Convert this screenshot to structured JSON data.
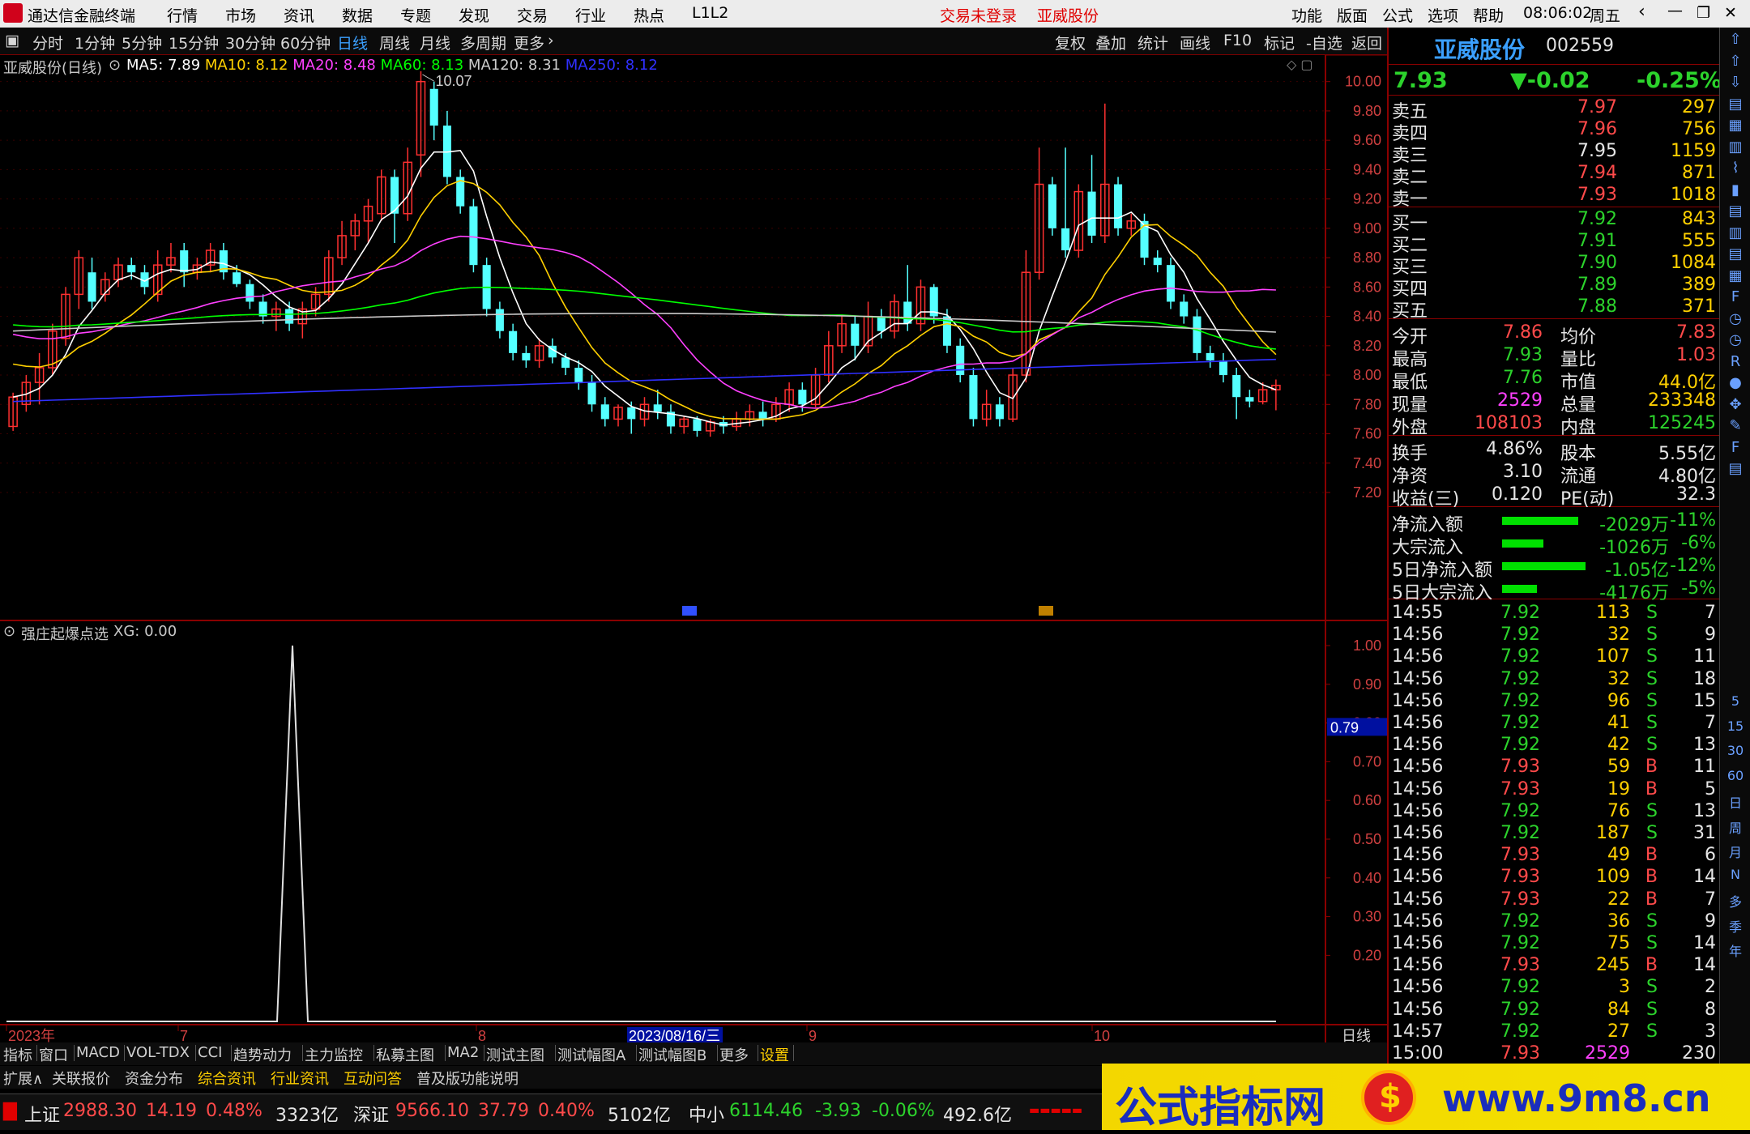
{
  "titlebar": {
    "app": "通达信金融终端",
    "menus": [
      "行情",
      "市场",
      "资讯",
      "数据",
      "专题",
      "发现",
      "交易",
      "行业",
      "热点",
      "L1L2"
    ],
    "login": "交易未登录",
    "stock": "亚威股份",
    "right_menus": [
      "功能",
      "版面",
      "公式",
      "选项",
      "帮助"
    ],
    "time": "08:06:02",
    "weekday": "周五"
  },
  "toolbar": {
    "periods": [
      "分时",
      "1分钟",
      "5分钟",
      "15分钟",
      "30分钟",
      "60分钟",
      "日线",
      "周线",
      "月线",
      "多周期",
      "更多"
    ],
    "active": "日线",
    "right": [
      "复权",
      "叠加",
      "统计",
      "画线",
      "F10",
      "标记",
      "-自选",
      "返回"
    ]
  },
  "main": {
    "legend_name": "亚威股份(日线)",
    "ma": [
      {
        "label": "MA5: 7.89",
        "color": "#ffffff"
      },
      {
        "label": "MA10: 8.12",
        "color": "#ffd000"
      },
      {
        "label": "MA20: 8.48",
        "color": "#ff40ff"
      },
      {
        "label": "MA60: 8.13",
        "color": "#00ff00"
      },
      {
        "label": "MA120: 8.31",
        "color": "#cccccc"
      },
      {
        "label": "MA250: 8.12",
        "color": "#3030ff"
      }
    ],
    "high_label": "10.07",
    "yticks": [
      "10.00",
      "9.80",
      "9.60",
      "9.40",
      "9.20",
      "9.00",
      "8.80",
      "8.60",
      "8.40",
      "8.20",
      "8.00",
      "7.80",
      "7.60",
      "7.40",
      "7.20"
    ],
    "markers": [
      "财1",
      "财2"
    ]
  },
  "sub": {
    "legend": "强庄起爆点选",
    "value": "XG: 0.00",
    "yticks": [
      "1.00",
      "0.90",
      "0.80",
      "0.70",
      "0.60",
      "0.50",
      "0.40",
      "0.30",
      "0.20"
    ],
    "cursor_value": "0.79"
  },
  "xaxis": {
    "labels": [
      "2023年",
      "7",
      "8",
      "9",
      "10"
    ],
    "cursor_date": "2023/08/16/三",
    "period": "日线"
  },
  "quote": {
    "name": "亚威股份",
    "code": "002559",
    "price": "7.93",
    "change": "▼-0.02",
    "pct": "-0.25%",
    "asks": [
      {
        "label": "卖五",
        "price": "7.97",
        "vol": "297"
      },
      {
        "label": "卖四",
        "price": "7.96",
        "vol": "756"
      },
      {
        "label": "卖三",
        "price": "7.95",
        "vol": "1159"
      },
      {
        "label": "卖二",
        "price": "7.94",
        "vol": "871"
      },
      {
        "label": "卖一",
        "price": "7.93",
        "vol": "1018"
      }
    ],
    "bids": [
      {
        "label": "买一",
        "price": "7.92",
        "vol": "843"
      },
      {
        "label": "买二",
        "price": "7.91",
        "vol": "555"
      },
      {
        "label": "买三",
        "price": "7.90",
        "vol": "1084"
      },
      {
        "label": "买四",
        "price": "7.89",
        "vol": "389"
      },
      {
        "label": "买五",
        "price": "7.88",
        "vol": "371"
      }
    ],
    "stats": [
      [
        "今开",
        "7.86",
        "均价",
        "7.83"
      ],
      [
        "最高",
        "7.93",
        "量比",
        "1.03"
      ],
      [
        "最低",
        "7.76",
        "市值",
        "44.0亿"
      ],
      [
        "现量",
        "2529",
        "总量",
        "233348"
      ],
      [
        "外盘",
        "108103",
        "内盘",
        "125245"
      ]
    ],
    "stats2": [
      [
        "换手",
        "4.86%",
        "股本",
        "5.55亿"
      ],
      [
        "净资",
        "3.10",
        "流通",
        "4.80亿"
      ],
      [
        "收益(三)",
        "0.120",
        "PE(动)",
        "32.3"
      ]
    ],
    "flows": [
      {
        "label": "净流入额",
        "val": "-2029万",
        "pct": "-11%",
        "bar": 0.11
      },
      {
        "label": "大宗流入",
        "val": "-1026万",
        "pct": "-6%",
        "bar": 0.06
      },
      {
        "label": "5日净流入额",
        "val": "-1.05亿",
        "pct": "-12%",
        "bar": 0.12
      },
      {
        "label": "5日大宗流入",
        "val": "-4176万",
        "pct": "-5%",
        "bar": 0.05
      }
    ],
    "ticks": [
      [
        "14:55",
        "7.92",
        "113",
        "S",
        "7"
      ],
      [
        "14:56",
        "7.92",
        "32",
        "S",
        "9"
      ],
      [
        "14:56",
        "7.92",
        "107",
        "S",
        "11"
      ],
      [
        "14:56",
        "7.92",
        "32",
        "S",
        "18"
      ],
      [
        "14:56",
        "7.92",
        "96",
        "S",
        "15"
      ],
      [
        "14:56",
        "7.92",
        "41",
        "S",
        "7"
      ],
      [
        "14:56",
        "7.92",
        "42",
        "S",
        "13"
      ],
      [
        "14:56",
        "7.93",
        "59",
        "B",
        "11"
      ],
      [
        "14:56",
        "7.93",
        "19",
        "B",
        "5"
      ],
      [
        "14:56",
        "7.92",
        "76",
        "S",
        "13"
      ],
      [
        "14:56",
        "7.92",
        "187",
        "S",
        "31"
      ],
      [
        "14:56",
        "7.93",
        "49",
        "B",
        "6"
      ],
      [
        "14:56",
        "7.93",
        "109",
        "B",
        "14"
      ],
      [
        "14:56",
        "7.93",
        "22",
        "B",
        "7"
      ],
      [
        "14:56",
        "7.92",
        "36",
        "S",
        "9"
      ],
      [
        "14:56",
        "7.92",
        "75",
        "S",
        "14"
      ],
      [
        "14:56",
        "7.93",
        "245",
        "B",
        "14"
      ],
      [
        "14:56",
        "7.92",
        "3",
        "S",
        "2"
      ],
      [
        "14:56",
        "7.92",
        "84",
        "S",
        "8"
      ],
      [
        "14:57",
        "7.92",
        "27",
        "S",
        "3"
      ],
      [
        "15:00",
        "7.93",
        "2529",
        "",
        "230"
      ]
    ]
  },
  "sidebar": [
    "5",
    "15",
    "30",
    "60",
    "日",
    "周",
    "月",
    "N",
    "多",
    "季",
    "年"
  ],
  "tabs1": [
    "指标",
    "窗口",
    "MACD",
    "VOL-TDX",
    "CCI",
    "趋势动力",
    "主力监控",
    "私募主图",
    "MA2",
    "测试主图",
    "测试幅图A",
    "测试幅图B",
    "更多",
    "设置"
  ],
  "tabs2": [
    "扩展∧",
    "关联报价",
    "资金分布",
    "综合资讯",
    "行业资讯",
    "互动问答",
    "普及版功能说明"
  ],
  "status": {
    "sh_name": "上证",
    "sh": "2988.30",
    "sh_chg": "14.19",
    "sh_pct": "0.48%",
    "sh_amt": "3323亿",
    "sz_name": "深证",
    "sz": "9566.10",
    "sz_chg": "37.79",
    "sz_pct": "0.40%",
    "sz_amt": "5102亿",
    "zx_name": "中小",
    "zx": "6114.46",
    "zx_chg": "-3.93",
    "zx_pct": "-0.06%",
    "zx_amt": "492.6亿"
  },
  "banner": {
    "text": "公式指标网",
    "url": "www.9m8.cn"
  },
  "chart_data": {
    "type": "candlestick",
    "ylim": [
      7.2,
      10.07
    ],
    "candles": [
      [
        7.65,
        7.85,
        7.88,
        7.62
      ],
      [
        7.8,
        7.95,
        8.0,
        7.75
      ],
      [
        7.95,
        8.05,
        8.15,
        7.8
      ],
      [
        8.05,
        8.3,
        8.35,
        8.0
      ],
      [
        8.25,
        8.55,
        8.6,
        8.2
      ],
      [
        8.55,
        8.8,
        8.85,
        8.45
      ],
      [
        8.7,
        8.5,
        8.8,
        8.45
      ],
      [
        8.55,
        8.65,
        8.7,
        8.5
      ],
      [
        8.65,
        8.75,
        8.8,
        8.6
      ],
      [
        8.75,
        8.7,
        8.8,
        8.65
      ],
      [
        8.7,
        8.6,
        8.75,
        8.55
      ],
      [
        8.55,
        8.75,
        8.85,
        8.5
      ],
      [
        8.75,
        8.8,
        8.9,
        8.7
      ],
      [
        8.85,
        8.7,
        8.9,
        8.6
      ],
      [
        8.7,
        8.75,
        8.8,
        8.65
      ],
      [
        8.75,
        8.85,
        8.9,
        8.7
      ],
      [
        8.85,
        8.7,
        8.9,
        8.65
      ],
      [
        8.7,
        8.62,
        8.75,
        8.6
      ],
      [
        8.62,
        8.5,
        8.65,
        8.45
      ],
      [
        8.5,
        8.4,
        8.55,
        8.35
      ],
      [
        8.4,
        8.45,
        8.5,
        8.3
      ],
      [
        8.45,
        8.35,
        8.5,
        8.3
      ],
      [
        8.35,
        8.45,
        8.5,
        8.25
      ],
      [
        8.45,
        8.55,
        8.6,
        8.4
      ],
      [
        8.55,
        8.8,
        8.85,
        8.5
      ],
      [
        8.8,
        8.95,
        9.05,
        8.75
      ],
      [
        8.95,
        9.05,
        9.1,
        8.85
      ],
      [
        9.05,
        9.15,
        9.2,
        8.9
      ],
      [
        9.1,
        9.35,
        9.4,
        9.05
      ],
      [
        9.35,
        9.1,
        9.4,
        8.9
      ],
      [
        9.1,
        9.45,
        9.55,
        9.05
      ],
      [
        9.5,
        10.0,
        10.07,
        9.35
      ],
      [
        9.95,
        9.7,
        10.0,
        9.6
      ],
      [
        9.7,
        9.35,
        9.8,
        9.3
      ],
      [
        9.35,
        9.15,
        9.4,
        9.1
      ],
      [
        9.15,
        8.75,
        9.2,
        8.7
      ],
      [
        8.75,
        8.45,
        8.8,
        8.4
      ],
      [
        8.45,
        8.3,
        8.5,
        8.25
      ],
      [
        8.3,
        8.15,
        8.35,
        8.1
      ],
      [
        8.15,
        8.1,
        8.2,
        8.05
      ],
      [
        8.1,
        8.2,
        8.25,
        8.05
      ],
      [
        8.2,
        8.12,
        8.25,
        8.08
      ],
      [
        8.12,
        8.05,
        8.15,
        8.0
      ],
      [
        8.05,
        7.95,
        8.1,
        7.9
      ],
      [
        7.95,
        7.8,
        8.0,
        7.75
      ],
      [
        7.8,
        7.7,
        7.85,
        7.65
      ],
      [
        7.7,
        7.78,
        7.8,
        7.65
      ],
      [
        7.78,
        7.7,
        7.82,
        7.6
      ],
      [
        7.7,
        7.8,
        7.85,
        7.65
      ],
      [
        7.8,
        7.75,
        7.9,
        7.7
      ],
      [
        7.75,
        7.65,
        7.8,
        7.6
      ],
      [
        7.65,
        7.7,
        7.72,
        7.6
      ],
      [
        7.7,
        7.62,
        7.72,
        7.58
      ],
      [
        7.62,
        7.68,
        7.7,
        7.58
      ],
      [
        7.68,
        7.65,
        7.72,
        7.6
      ],
      [
        7.65,
        7.7,
        7.75,
        7.62
      ],
      [
        7.7,
        7.75,
        7.8,
        7.65
      ],
      [
        7.75,
        7.7,
        7.82,
        7.65
      ],
      [
        7.7,
        7.8,
        7.85,
        7.68
      ],
      [
        7.8,
        7.9,
        7.95,
        7.75
      ],
      [
        7.9,
        7.8,
        7.95,
        7.75
      ],
      [
        7.8,
        8.0,
        8.05,
        7.78
      ],
      [
        8.0,
        8.2,
        8.3,
        7.95
      ],
      [
        8.2,
        8.35,
        8.4,
        8.15
      ],
      [
        8.35,
        8.2,
        8.4,
        8.1
      ],
      [
        8.2,
        8.4,
        8.5,
        8.15
      ],
      [
        8.4,
        8.3,
        8.45,
        8.25
      ],
      [
        8.3,
        8.5,
        8.55,
        8.25
      ],
      [
        8.5,
        8.35,
        8.75,
        8.3
      ],
      [
        8.35,
        8.6,
        8.65,
        8.3
      ],
      [
        8.6,
        8.4,
        8.62,
        8.35
      ],
      [
        8.4,
        8.2,
        8.45,
        8.15
      ],
      [
        8.2,
        8.0,
        8.25,
        7.95
      ],
      [
        8.0,
        7.7,
        8.05,
        7.65
      ],
      [
        7.7,
        7.8,
        7.9,
        7.65
      ],
      [
        7.8,
        7.7,
        7.85,
        7.65
      ],
      [
        7.7,
        8.0,
        8.05,
        7.68
      ],
      [
        8.0,
        8.7,
        8.85,
        7.95
      ],
      [
        8.7,
        9.3,
        9.55,
        8.65
      ],
      [
        9.3,
        9.0,
        9.35,
        8.95
      ],
      [
        9.0,
        8.85,
        9.55,
        8.8
      ],
      [
        8.85,
        9.25,
        9.3,
        8.8
      ],
      [
        9.25,
        8.95,
        9.5,
        8.9
      ],
      [
        8.95,
        9.3,
        9.85,
        8.9
      ],
      [
        9.3,
        9.0,
        9.35,
        8.95
      ],
      [
        9.0,
        9.05,
        9.1,
        8.95
      ],
      [
        9.05,
        8.8,
        9.1,
        8.75
      ],
      [
        8.8,
        8.75,
        8.85,
        8.7
      ],
      [
        8.75,
        8.5,
        8.8,
        8.45
      ],
      [
        8.5,
        8.4,
        8.55,
        8.35
      ],
      [
        8.4,
        8.15,
        8.45,
        8.1
      ],
      [
        8.15,
        8.1,
        8.2,
        8.05
      ],
      [
        8.1,
        8.0,
        8.15,
        7.95
      ],
      [
        8.0,
        7.85,
        8.05,
        7.7
      ],
      [
        7.85,
        7.82,
        7.9,
        7.78
      ],
      [
        7.82,
        7.9,
        7.95,
        7.8
      ],
      [
        7.9,
        7.93,
        7.97,
        7.76
      ]
    ]
  }
}
